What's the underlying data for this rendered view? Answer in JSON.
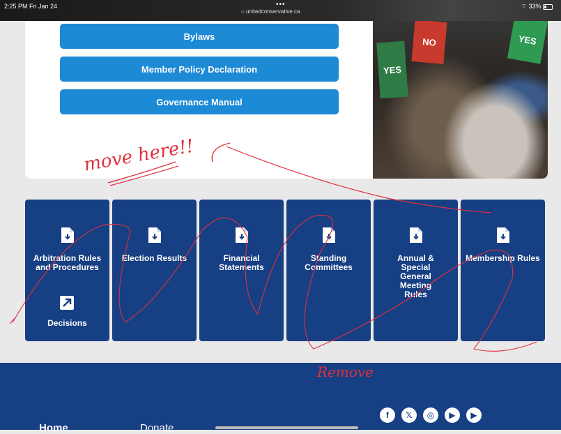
{
  "status_bar": {
    "time": "2:25 PM  Fri Jan 24",
    "dots": "•••",
    "url": "⌂ unitedconservative.ca",
    "battery": "33%"
  },
  "governance_buttons": [
    "Bylaws",
    "Member Policy Declaration",
    "Governance Manual"
  ],
  "photo": {
    "sign_yes_1": "YES",
    "sign_no": "NO",
    "sign_yes_2": "YES"
  },
  "tiles": [
    {
      "label": "Arbitration Rules and Procedures",
      "secondary_label": "Decisions"
    },
    {
      "label": "Election Results"
    },
    {
      "label": "Financial Statements"
    },
    {
      "label": "Standing Committees"
    },
    {
      "label": "Annual & Special General Meeting Rules"
    },
    {
      "label": "Membership Rules"
    }
  ],
  "annotations": {
    "top_note": "move here!!",
    "bottom_note": "Remove"
  },
  "footer": {
    "home": "Home",
    "donate": "Donate",
    "social": [
      {
        "icon": "facebook-icon",
        "glyph": "f"
      },
      {
        "icon": "x-icon",
        "glyph": "𝕏"
      },
      {
        "icon": "instagram-icon",
        "glyph": "◎"
      },
      {
        "icon": "rumble-icon",
        "glyph": "▶"
      },
      {
        "icon": "youtube-icon",
        "glyph": "▶"
      }
    ]
  },
  "colors": {
    "button_blue": "#1d8ad6",
    "tile_navy": "#173f83",
    "annotation_red": "#e0313d"
  }
}
